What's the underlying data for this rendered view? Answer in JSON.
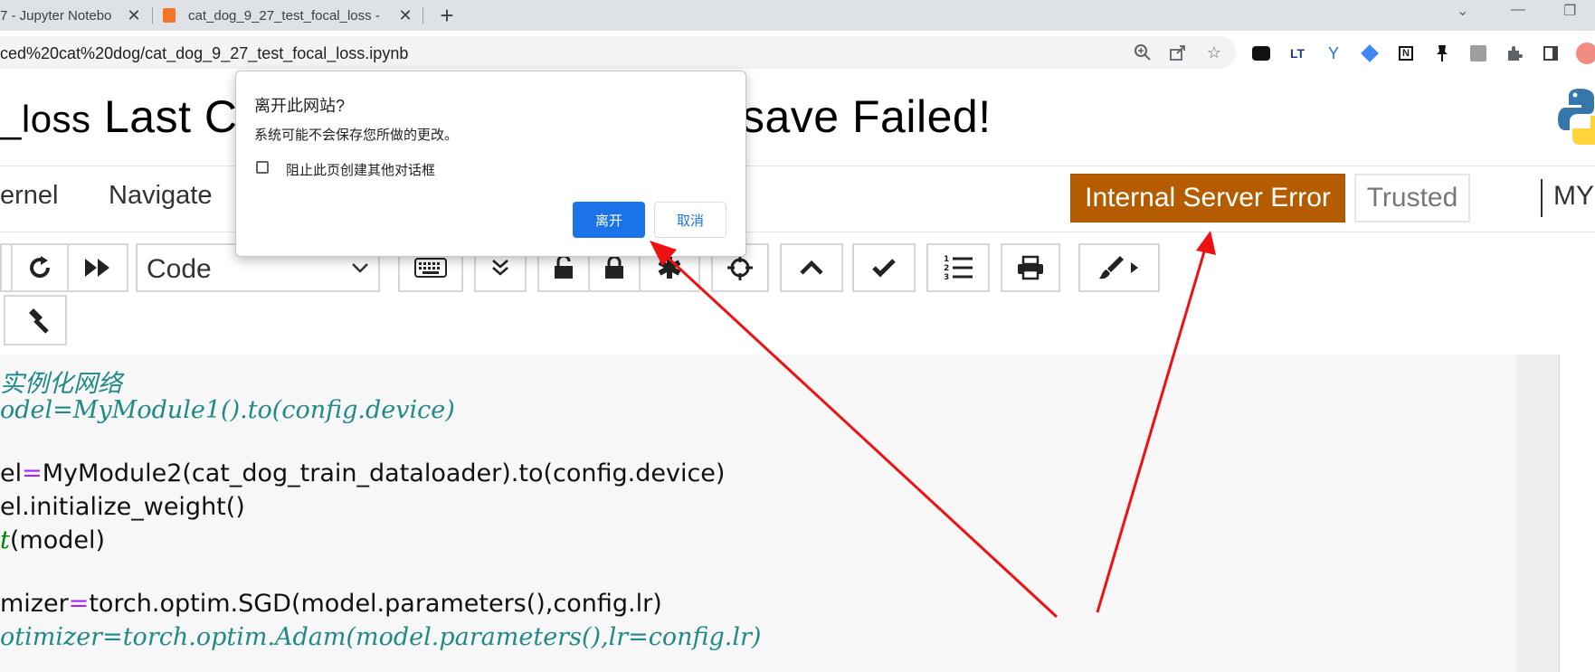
{
  "browser": {
    "tabs": [
      {
        "title": "7 - Jupyter Notebo"
      },
      {
        "title": "cat_dog_9_27_test_focal_loss -"
      }
    ],
    "url": "ced%20cat%20dog/cat_dog_9_27_test_focal_loss.ipynb"
  },
  "notebook": {
    "title_left": "_loss",
    "title_mid": "Last Cl",
    "title_right": "save Failed!",
    "menu": [
      "ernel",
      "Navigate"
    ],
    "kernel_status": "Internal Server Error",
    "trusted": "Trusted",
    "user_label": "MY",
    "cell_type": "Code",
    "code": [
      {
        "segments": [
          {
            "t": "实例化网络",
            "c": "c-comment"
          }
        ]
      },
      {
        "segments": [
          {
            "t": "odel=MyModule1().to(config.device)",
            "c": "c-comment"
          }
        ]
      },
      {
        "segments": []
      },
      {
        "segments": [
          {
            "t": "el",
            "c": "c-plain"
          },
          {
            "t": "=",
            "c": "c-op"
          },
          {
            "t": "MyModule2(cat_dog_train_dataloader).to(config.device)",
            "c": "c-plain"
          }
        ]
      },
      {
        "segments": [
          {
            "t": "el.initialize_weight()",
            "c": "c-plain"
          }
        ]
      },
      {
        "segments": [
          {
            "t": "t",
            "c": "c-builtin"
          },
          {
            "t": "(model)",
            "c": "c-plain"
          }
        ]
      },
      {
        "segments": []
      },
      {
        "segments": [
          {
            "t": "mizer",
            "c": "c-plain"
          },
          {
            "t": "=",
            "c": "c-op"
          },
          {
            "t": "torch.optim.SGD(model.parameters(),config.lr)",
            "c": "c-plain"
          }
        ]
      },
      {
        "segments": [
          {
            "t": "otimizer=torch.optim.Adam(model.parameters(),lr=config.lr)",
            "c": "c-comment"
          }
        ]
      }
    ]
  },
  "dialog": {
    "title": "离开此网站?",
    "message": "系统可能不会保存您所做的更改。",
    "checkbox_label": "阻止此页创建其他对话框",
    "leave_button": "离开",
    "cancel_button": "取消"
  },
  "colors": {
    "error_bg": "#b65c00",
    "dialog_primary": "#1a73e8",
    "annotation_arrow": "#ee1111"
  }
}
